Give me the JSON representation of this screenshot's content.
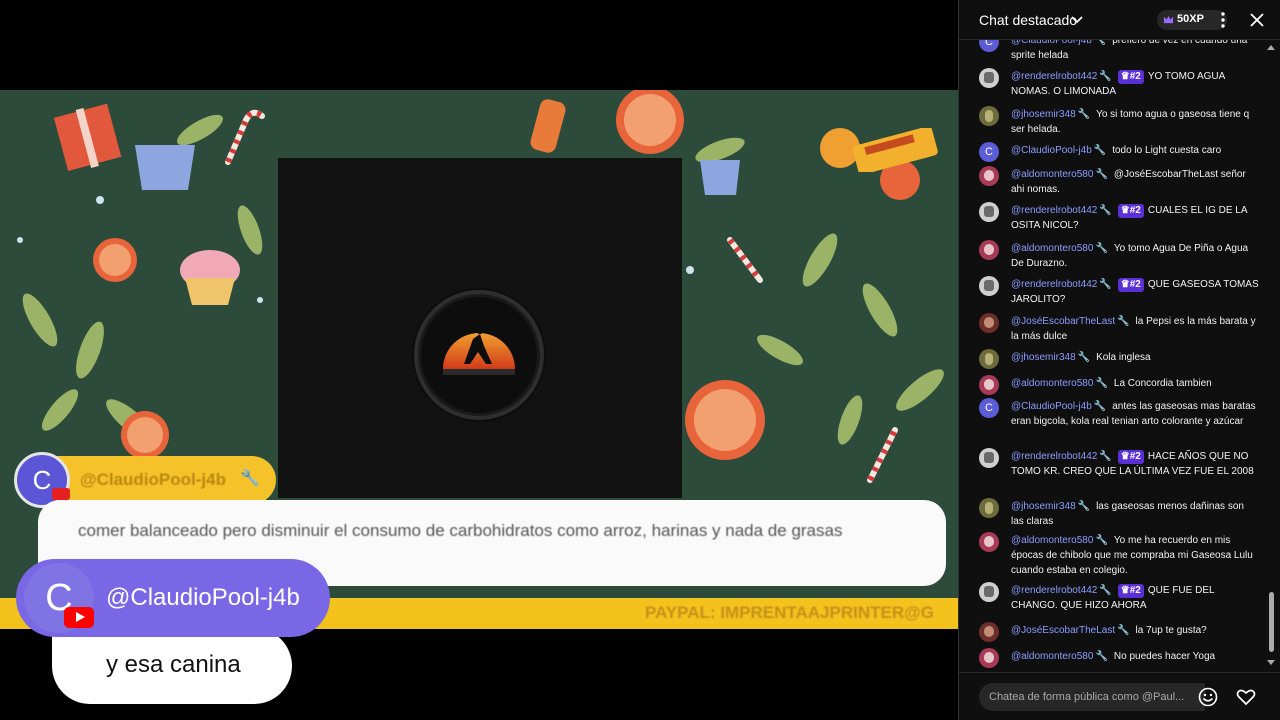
{
  "video": {
    "overlay_chat": {
      "avatar_letter": "C",
      "name": "@ClaudioPool-j4b",
      "message": "comer balanceado pero disminuir el consumo de carbohidratos como arroz, harinas y nada de grasas"
    },
    "ticker_text": "PAYPAL: IMPRENTAAJPRINTER@G",
    "big_overlay": {
      "avatar_letter": "C",
      "name": "@ClaudioPool-j4b",
      "message": "y esa canina"
    }
  },
  "chat": {
    "title": "Chat destacado",
    "xp": "50XP",
    "input_placeholder": "Chatea de forma pública como @Paul...",
    "messages": [
      {
        "avatar": "c",
        "letter": "C",
        "author": "@ClaudioPool-j4b",
        "rank": "",
        "text": "prefiero de vez en cuando una sprite helada"
      },
      {
        "avatar": "r",
        "letter": "",
        "author": "@renderelrobot442",
        "rank": "#2",
        "text": "YO TOMO AGUA NOMAS. O LIMONADA"
      },
      {
        "avatar": "j",
        "letter": "",
        "author": "@jhosemir348",
        "rank": "",
        "text": "Yo si tomo agua o gaseosa tiene q ser helada."
      },
      {
        "avatar": "c",
        "letter": "C",
        "author": "@ClaudioPool-j4b",
        "rank": "",
        "text": "todo lo Light cuesta caro"
      },
      {
        "avatar": "a",
        "letter": "",
        "author": "@aldomontero580",
        "rank": "",
        "text": "@JoséEscobarTheLast señor ahi nomas."
      },
      {
        "avatar": "r",
        "letter": "",
        "author": "@renderelrobot442",
        "rank": "#2",
        "text": "CUALES EL IG DE LA OSITA NICOL?"
      },
      {
        "avatar": "a",
        "letter": "",
        "author": "@aldomontero580",
        "rank": "",
        "text": "Yo tomo Agua De Piña o Agua De Durazno."
      },
      {
        "avatar": "r",
        "letter": "",
        "author": "@renderelrobot442",
        "rank": "#2",
        "text": "QUE GASEOSA TOMAS JAROLITO?"
      },
      {
        "avatar": "e",
        "letter": "",
        "author": "@JoséEscobarTheLast",
        "rank": "",
        "text": "la Pepsi es la más barata y la más dulce"
      },
      {
        "avatar": "j",
        "letter": "",
        "author": "@jhosemir348",
        "rank": "",
        "text": "Kola inglesa"
      },
      {
        "avatar": "a",
        "letter": "",
        "author": "@aldomontero580",
        "rank": "",
        "text": "La Concordia tambien"
      },
      {
        "avatar": "c",
        "letter": "C",
        "author": "@ClaudioPool-j4b",
        "rank": "",
        "text": "antes las gaseosas mas baratas eran bigcola, kola real tenian arto colorante y azúcar"
      },
      {
        "avatar": "r",
        "letter": "",
        "author": "@renderelrobot442",
        "rank": "#2",
        "text": "HACE AÑOS QUE NO TOMO KR. CREO QUE LA ÚLTIMA VEZ FUE EL 2008"
      },
      {
        "avatar": "j",
        "letter": "",
        "author": "@jhosemir348",
        "rank": "",
        "text": "las gaseosas menos dañinas son las claras"
      },
      {
        "avatar": "a",
        "letter": "",
        "author": "@aldomontero580",
        "rank": "",
        "text": "Yo me ha recuerdo en mis épocas de chibolo que me compraba mi Gaseosa Lulu cuando estaba en colegio."
      },
      {
        "avatar": "r",
        "letter": "",
        "author": "@renderelrobot442",
        "rank": "#2",
        "text": "QUE FUE DEL CHANGO. QUE HIZO AHORA"
      },
      {
        "avatar": "e",
        "letter": "",
        "author": "@JoséEscobarTheLast",
        "rank": "",
        "text": "la 7up te gusta?"
      },
      {
        "avatar": "a",
        "letter": "",
        "author": "@aldomontero580",
        "rank": "",
        "text": "No puedes hacer Yoga"
      }
    ]
  }
}
